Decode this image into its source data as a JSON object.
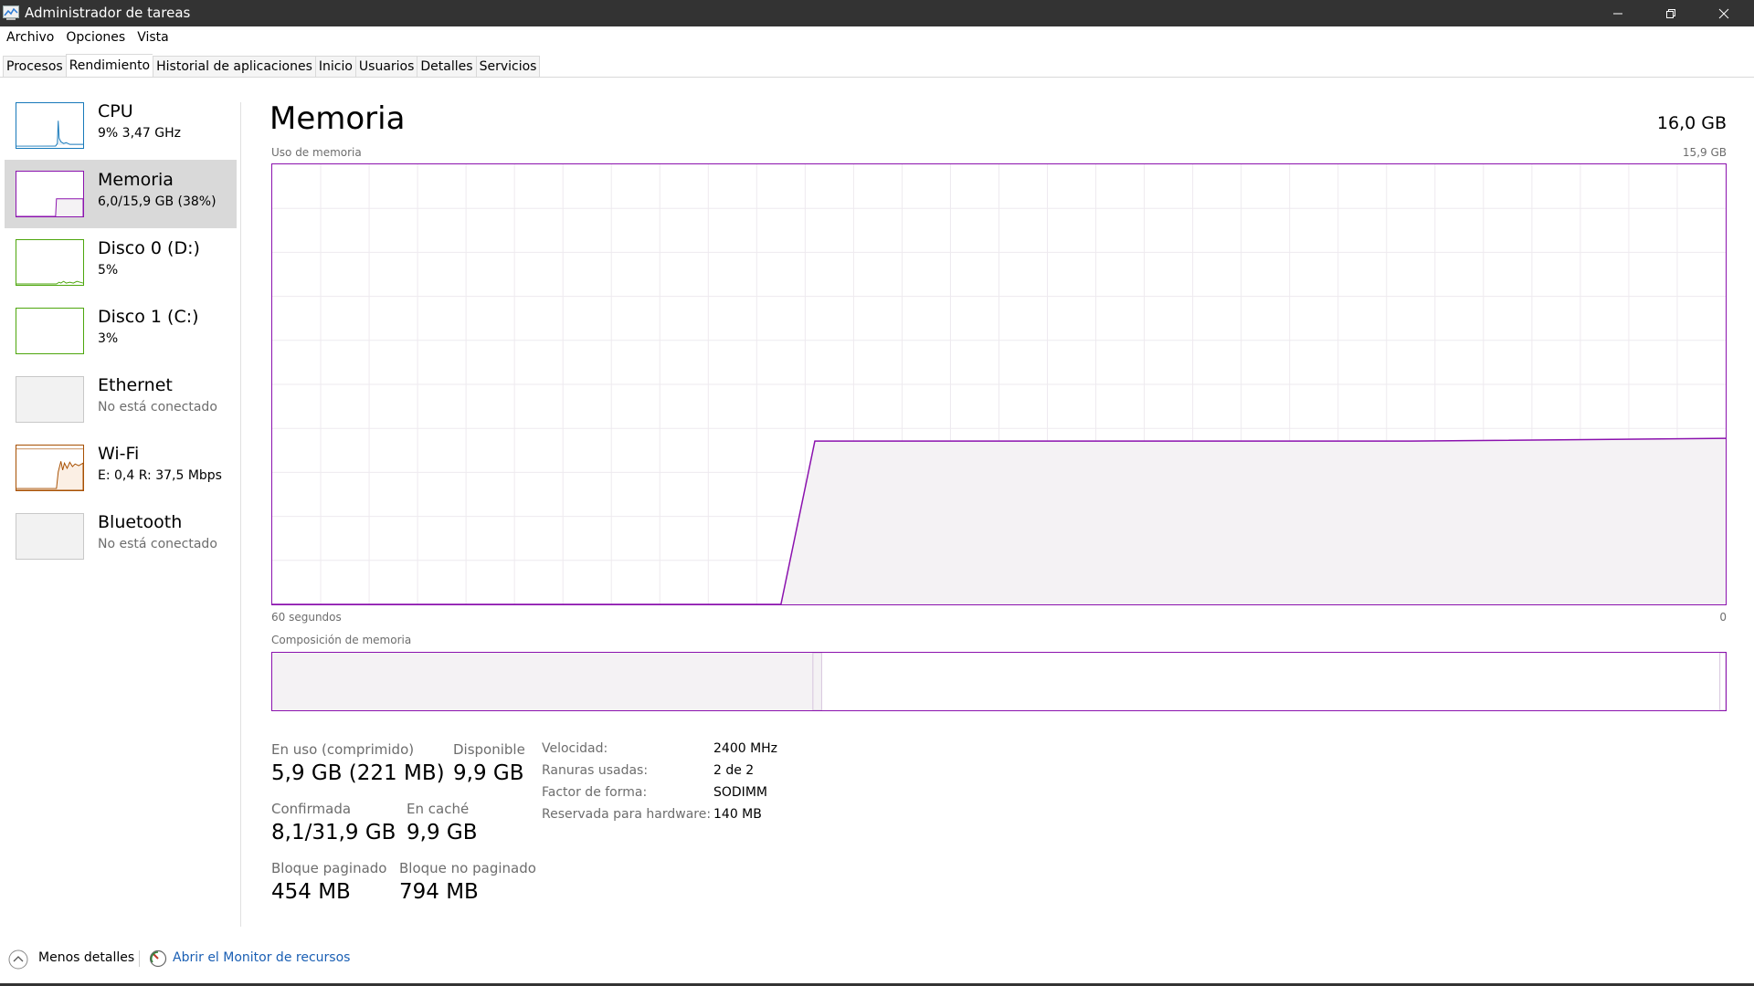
{
  "window": {
    "title": "Administrador de tareas"
  },
  "menu": [
    "Archivo",
    "Opciones",
    "Vista"
  ],
  "tabs": [
    "Procesos",
    "Rendimiento",
    "Historial de aplicaciones",
    "Inicio",
    "Usuarios",
    "Detalles",
    "Servicios"
  ],
  "active_tab": "Rendimiento",
  "sidebar": [
    {
      "title": "CPU",
      "sub": "9%  3,47 GHz",
      "color": "#1779ba"
    },
    {
      "title": "Memoria",
      "sub": "6,0/15,9 GB (38%)",
      "color": "#8b12ae"
    },
    {
      "title": "Disco 0 (D:)",
      "sub": "5%",
      "color": "#4da60c"
    },
    {
      "title": "Disco 1 (C:)",
      "sub": "3%",
      "color": "#4da60c"
    },
    {
      "title": "Ethernet",
      "sub": "No está conectado",
      "color": "#a7a7a7"
    },
    {
      "title": "Wi-Fi",
      "sub": "E: 0,4  R: 37,5 Mbps",
      "color": "#a74f01"
    },
    {
      "title": "Bluetooth",
      "sub": "No está conectado",
      "color": "#a7a7a7"
    }
  ],
  "main": {
    "title": "Memoria",
    "total": "16,0 GB",
    "usage_label": "Uso de memoria",
    "usage_max": "15,9 GB",
    "x_left": "60 segundos",
    "x_right": "0",
    "composition_label": "Composición de memoria"
  },
  "chart_data": {
    "type": "area",
    "title": "Uso de memoria",
    "x_range_label": [
      "60 segundos",
      "0"
    ],
    "ylim": [
      0,
      15.9
    ],
    "x": [
      60,
      39,
      37.6,
      13,
      0
    ],
    "values": [
      0,
      0,
      5.9,
      5.9,
      6.0
    ]
  },
  "composition": {
    "in_use_fraction": 0.372,
    "modified_fraction": 0.006,
    "standby_fraction": 0.617,
    "free_fraction": 0.004
  },
  "stats": {
    "in_use_label": "En uso (comprimido)",
    "in_use_value": "5,9 GB (221 MB)",
    "available_label": "Disponible",
    "available_value": "9,9 GB",
    "committed_label": "Confirmada",
    "committed_value": "8,1/31,9 GB",
    "cached_label": "En caché",
    "cached_value": "9,9 GB",
    "paged_label": "Bloque paginado",
    "paged_value": "454 MB",
    "nonpaged_label": "Bloque no paginado",
    "nonpaged_value": "794 MB"
  },
  "specs": [
    {
      "key": "Velocidad:",
      "value": "2400 MHz"
    },
    {
      "key": "Ranuras usadas:",
      "value": "2 de 2"
    },
    {
      "key": "Factor de forma:",
      "value": "SODIMM"
    },
    {
      "key": "Reservada para hardware:",
      "value": "140 MB"
    }
  ],
  "footer": {
    "fewer_details": "Menos detalles",
    "resource_monitor": "Abrir el Monitor de recursos"
  }
}
